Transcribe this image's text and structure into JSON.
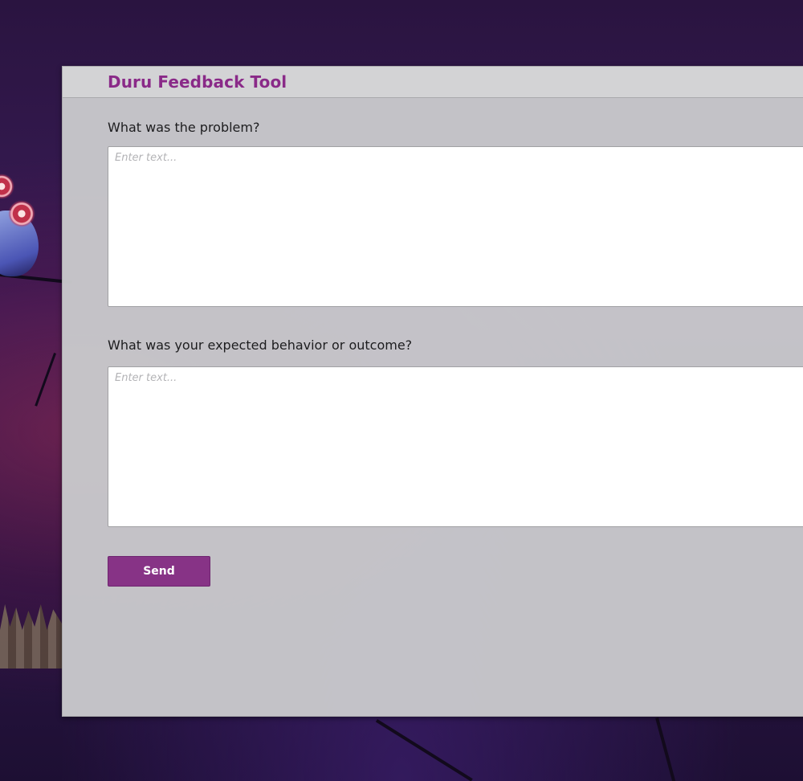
{
  "dialog": {
    "title": "Duru Feedback Tool",
    "accent_color": "#873386"
  },
  "fields": [
    {
      "label": "What was the problem?",
      "placeholder": "Enter text...",
      "value": ""
    },
    {
      "label": "What was your expected behavior or outcome?",
      "placeholder": "Enter text...",
      "value": ""
    }
  ],
  "actions": {
    "send_label": "Send"
  }
}
